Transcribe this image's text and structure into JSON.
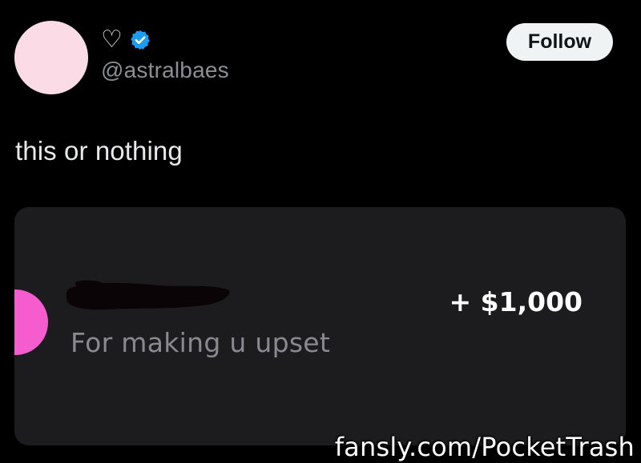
{
  "post": {
    "display_name_icon": "heart-outline-icon",
    "verified_icon": "verified-badge-icon",
    "handle": "@astralbaes",
    "follow_label": "Follow",
    "text": "this or nothing"
  },
  "card": {
    "sender_name_redacted": true,
    "note": "For making u upset",
    "amount": "+ $1,000"
  },
  "watermark": "fansly.com/PocketTrash",
  "colors": {
    "background": "#000000",
    "avatar": "#fbdbe6",
    "verified": "#1d9bf0",
    "card_background": "#1c1c1e",
    "card_avatar": "#f55ccd",
    "follow_button": "#eff3f4"
  }
}
